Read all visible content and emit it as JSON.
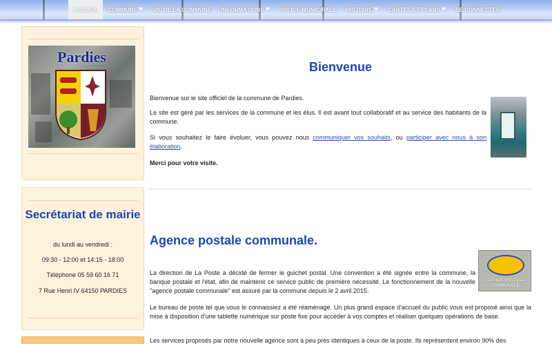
{
  "nav": {
    "items": [
      {
        "label": "ACCUEIL",
        "caret": false,
        "active": true
      },
      {
        "label": "COMMUNE",
        "caret": true
      },
      {
        "label": "VIE DE LA COMMUNE",
        "caret": false
      },
      {
        "label": "INFORMATIONS",
        "caret": true
      },
      {
        "label": "POLICE MUNICIPALE",
        "caret": false
      },
      {
        "label": "HISTOIRE",
        "caret": true
      },
      {
        "label": "CARTES ET PLANS",
        "caret": true
      },
      {
        "label": "SE CONNECTER",
        "caret": false
      }
    ]
  },
  "sidebar": {
    "logo_text": "Pardies",
    "secretariat": {
      "title": "Secrétariat de mairie",
      "days": "du lundi au vendredi :",
      "hours": "09:30 - 12:00 et 14:15 - 18:00",
      "phone": "Téléphone 05 59 60 16 71",
      "address": "7 Rue Henri IV 64150 PARDIES"
    }
  },
  "welcome": {
    "title": "Bienvenue",
    "p1": "Bienvenue sur le site officiel de la commune de Pardies.",
    "p2": "Le site est géré par les services de la commune et les élus. Il est avant tout collaboratif et au service des habitants de la commune.",
    "p3_before": "Si vous souhaitez le faire évoluer, vous pouvez nous ",
    "p3_link1": "communiquer vos souhaits",
    "p3_mid": ",  ou  ",
    "p3_link2": "participer avec nous à son élaboration",
    "p3_after": ".",
    "thanks": "Merci pour votre visite."
  },
  "agence": {
    "title": "Agence postale communale.",
    "logo_text": "AGENCE POSTALE COMMUNALE",
    "p1": "La direction de La Poste a décidé de fermer le guichet postal. Une convention a été signée entre la commune, la banque postale et l'état, afin de maintenir ce service public de première nécessité.  Le fonctionnement de la nouvelle \"agence postale communale\" est assuré par la commune depuis le 2 avril 2015.",
    "p2": "Le bureau de poste tel que vous le connaissiez a été réaménagé. Un plus grand espace d'accueil du public vous est proposé ainsi que la mise à disposition d'une tablette numérique sur poste fixe pour accéder à vos comptes et réaliser quelques opérations de base.",
    "p3": "Les services proposés par notre nouvelle agence sont à peu près identiques à ceux de la poste. Ils représentent environ 90% des"
  },
  "colors": {
    "accent": "#1b46b8",
    "sidebar_bg": "#fdf2dc",
    "link": "#2a4fb5"
  }
}
